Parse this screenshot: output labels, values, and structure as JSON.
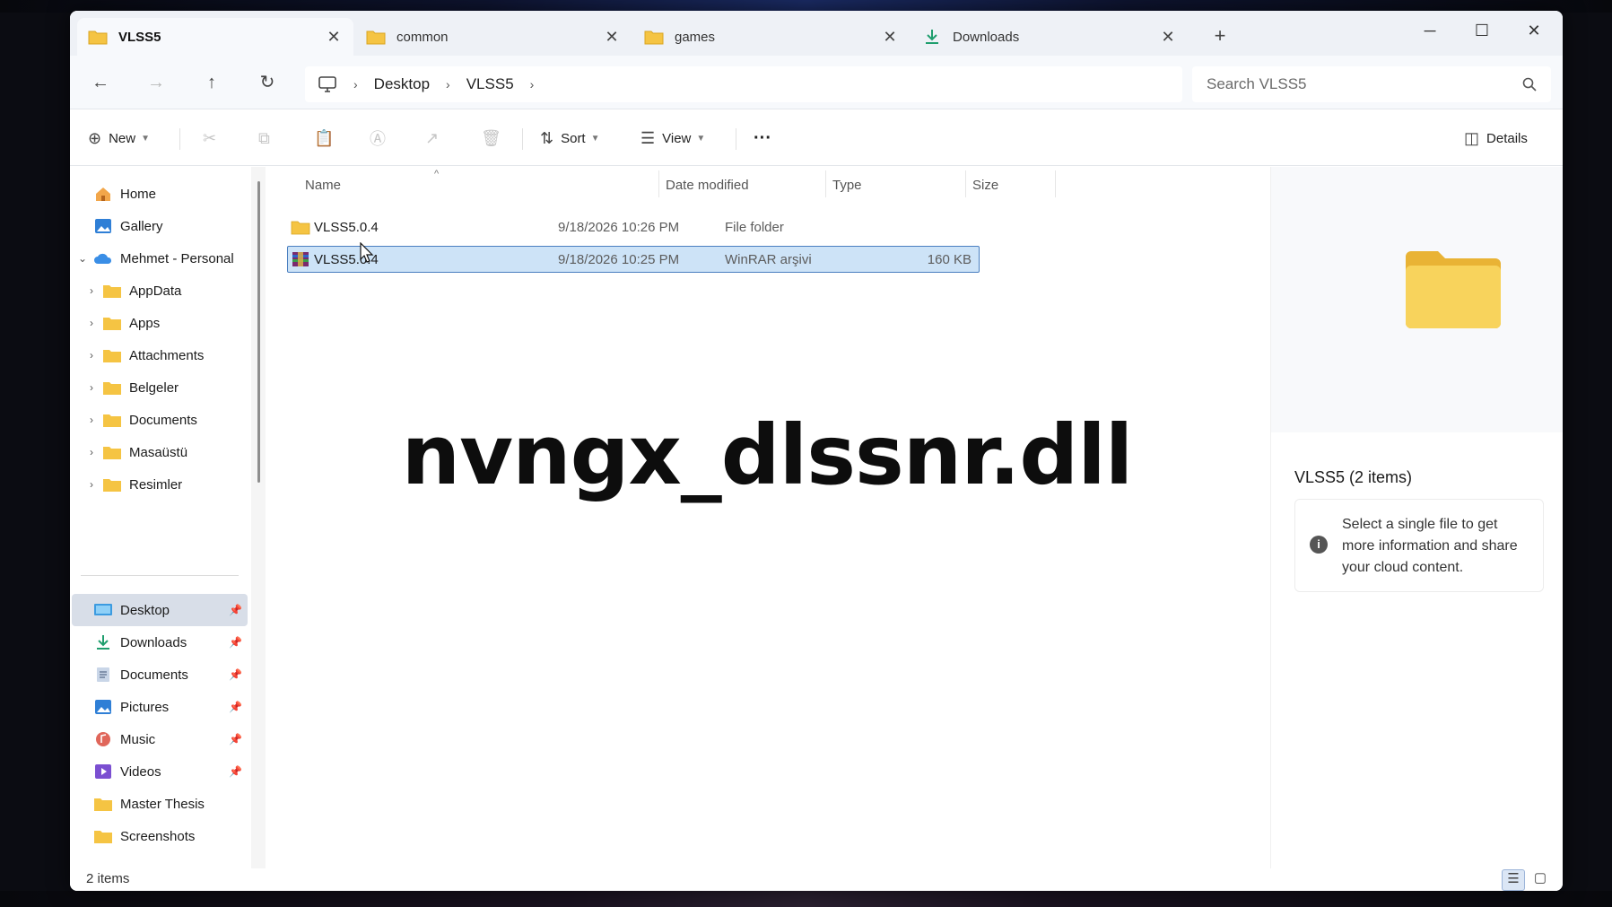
{
  "tabs": [
    {
      "label": "VLSS5",
      "icon": "folder-icon",
      "active": true
    },
    {
      "label": "common",
      "icon": "folder-icon",
      "active": false
    },
    {
      "label": "games",
      "icon": "folder-icon",
      "active": false
    },
    {
      "label": "Downloads",
      "icon": "download-icon",
      "active": false
    }
  ],
  "window_controls": {
    "minimize": "─",
    "maximize": "☐",
    "close": "✕",
    "new_tab": "+"
  },
  "nav": {
    "back": "←",
    "forward": "→",
    "up": "↑",
    "refresh": "↻"
  },
  "breadcrumb": {
    "items": [
      "Desktop",
      "VLSS5"
    ],
    "separator": "›"
  },
  "search": {
    "placeholder": "Search VLSS5"
  },
  "toolbar": {
    "new_label": "New",
    "sort_label": "Sort",
    "view_label": "View",
    "more_label": "···",
    "details_label": "Details"
  },
  "sidebar": {
    "top": [
      {
        "label": "Home",
        "icon": "home-icon"
      },
      {
        "label": "Gallery",
        "icon": "gallery-icon"
      },
      {
        "label": "Mehmet - Personal",
        "icon": "cloud-icon",
        "expanded": true
      }
    ],
    "cloud_children": [
      {
        "label": "AppData"
      },
      {
        "label": "Apps"
      },
      {
        "label": "Attachments"
      },
      {
        "label": "Belgeler"
      },
      {
        "label": "Documents"
      },
      {
        "label": "Masaüstü"
      },
      {
        "label": "Resimler"
      }
    ],
    "quick_access": [
      {
        "label": "Desktop",
        "icon": "desktop-icon",
        "pinned": true,
        "selected": true
      },
      {
        "label": "Downloads",
        "icon": "download-icon",
        "pinned": true
      },
      {
        "label": "Documents",
        "icon": "documents-icon",
        "pinned": true
      },
      {
        "label": "Pictures",
        "icon": "pictures-icon",
        "pinned": true
      },
      {
        "label": "Music",
        "icon": "music-icon",
        "pinned": true
      },
      {
        "label": "Videos",
        "icon": "videos-icon",
        "pinned": true
      },
      {
        "label": "Master Thesis",
        "icon": "folder-icon",
        "pinned": false
      },
      {
        "label": "Screenshots",
        "icon": "folder-icon",
        "pinned": false
      }
    ]
  },
  "columns": {
    "name": "Name",
    "date": "Date modified",
    "type": "Type",
    "size": "Size"
  },
  "files": [
    {
      "name": "VLSS5.0.4",
      "date": "9/18/2026 10:26 PM",
      "type": "File folder",
      "size": "",
      "icon": "folder-icon",
      "selected": false
    },
    {
      "name": "VLSS5.0.4",
      "date": "9/18/2026 10:25 PM",
      "type": "WinRAR arşivi",
      "size": "160 KB",
      "icon": "winrar-icon",
      "selected": true
    }
  ],
  "overlay": {
    "text": "nvngx_dlssnr.dll"
  },
  "details": {
    "title": "VLSS5 (2 items)",
    "info": "Select a single file to get more information and share your cloud content."
  },
  "status": {
    "count": "2 items"
  },
  "colors": {
    "folder": "#f5c443",
    "accent": "#4a7fc0",
    "selection": "#cde3f7"
  }
}
